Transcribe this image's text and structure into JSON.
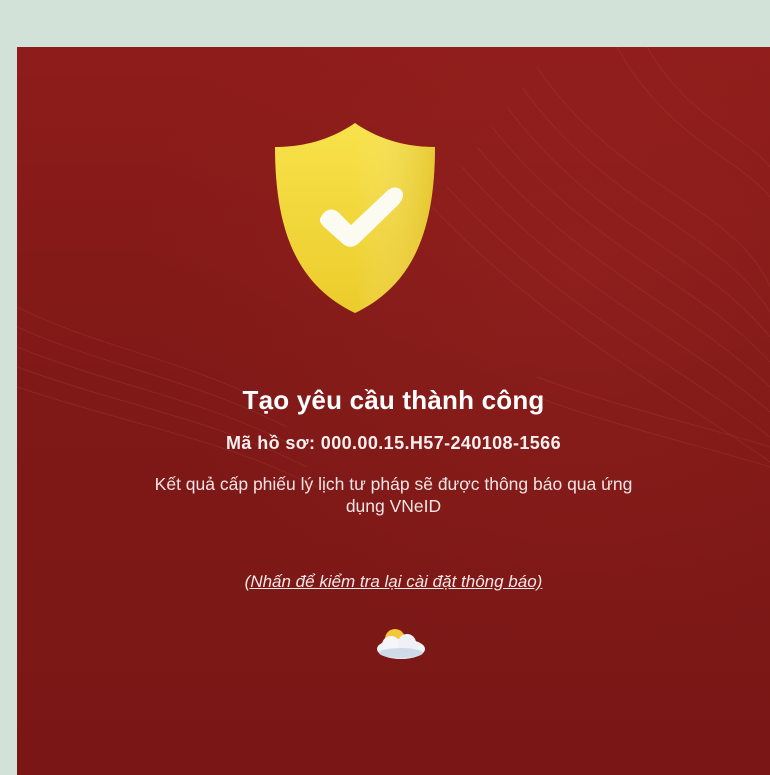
{
  "result": {
    "title": "Tạo yêu cầu thành công",
    "code_line": "Mã hồ sơ: 000.00.15.H57-240108-1566",
    "message_line1": "Kết quả cấp phiếu lý lịch tư pháp sẽ được thông báo qua ứng",
    "message_line2": "dụng VNeID",
    "settings_link": "(Nhấn để kiểm tra lại cài đặt thông báo)"
  },
  "icons": {
    "shield": "shield-check-icon",
    "weather": "sun-cloud-icon"
  },
  "colors": {
    "background_frame": "#d3e2d8",
    "screen_red": "#851a18",
    "shield_yellow": "#f4df3c",
    "text_white": "#ffffff"
  }
}
